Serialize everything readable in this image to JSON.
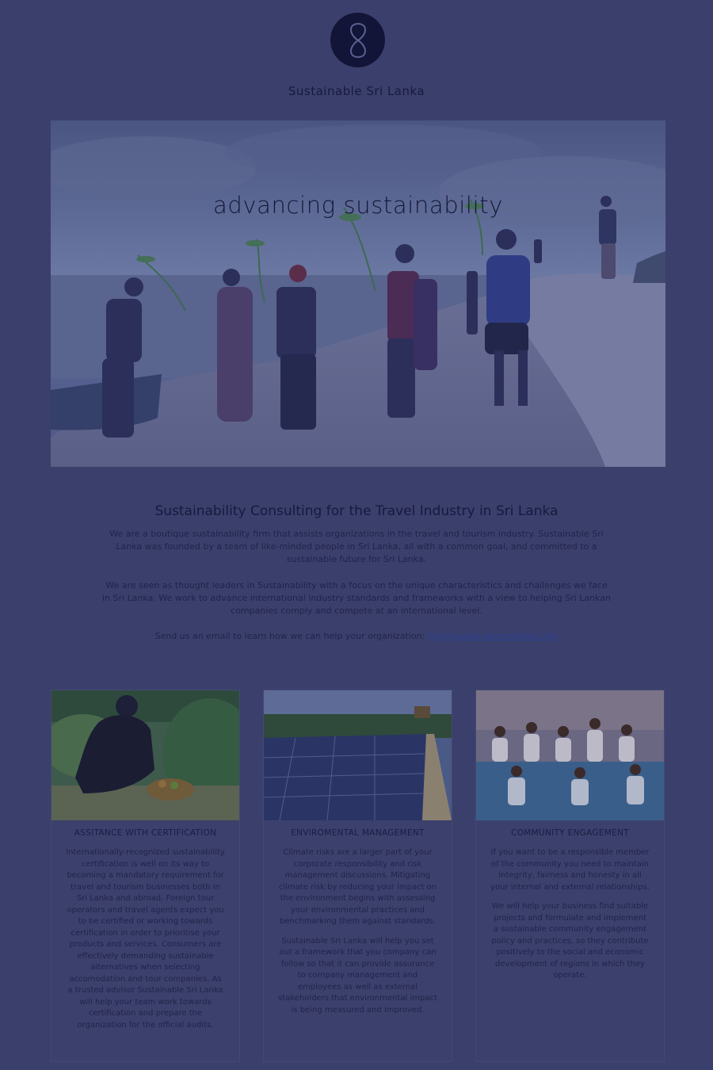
{
  "brand": {
    "name": "Sustainable Sri Lanka"
  },
  "hero": {
    "title": "advancing sustainability"
  },
  "intro": {
    "title": "Sustainability Consulting for the Travel Industry in Sri Lanka",
    "paragraph1": "We are a boutique sustainability firm that assists organizations in the travel and tourism industry. Sustainable Sri Lanka was founded by a team of like-minded people in Sri Lanka, all with a common goal, and committed to a sustainable future for Sri Lanka.",
    "paragraph2": "We are seen as thought leaders in Sustainability with a focus on the unique characteristics and challenges we face in Sri Lanka. We work to advance international industry standards and frameworks with a view to helping Sri Lankan companies comply and compete at an international level.",
    "contact_text": "Send us an email to learn how we can help your organization:",
    "contact_email": "info@sustainablesrilanka.com"
  },
  "services": [
    {
      "title": "ASSITANCE WITH CERTIFICATION",
      "paragraphs": [
        "Internationally-recognized sustainability certification is well on its way to becoming a mandatory requirement for travel and tourism businesses both in Sri Lanka and abroad. Foreign tour operators and travel agents expect you to be certified or working towards certification in order to prioritise your products and services. Consumers are effectively demanding sustainable alternatives when selecting accomodation and tour companies. As a trusted advisor Sustainable Sri Lanka will help your team work towards certification and prepare the organization for the official audits."
      ]
    },
    {
      "title": "ENVIROMENTAL MANAGEMENT",
      "paragraphs": [
        "Climate risks are a larger part of your corporate responsibility and risk management discussions. Mitigating climate risk by reducing your impact on the environment begins with assessing your environmental practices and benchmarking them against standards.",
        "Sustainable Sri Lanka will help you set out a framework that you company can follow so that it can provide assurance to company management and employees as well as external stakeholders that environmental impact is being measured and improved."
      ]
    },
    {
      "title": "COMMUNITY ENGAGEMENT",
      "paragraphs": [
        "If you want to be a responsible member of the community you need to maintain integrity, fairness and honesty in all your internal and external relationships.",
        "We will help your business find suitable projects and formulate and implement a sustainable community engagement policy and practices, so they contribute positively to the social and economic development of regions in which they operate."
      ]
    }
  ],
  "colors": {
    "page_background": "#3b3f6b",
    "logo_background": "#121538",
    "link": "#2c4191"
  },
  "icons": {
    "logo": "infinity-8-logo-icon"
  }
}
